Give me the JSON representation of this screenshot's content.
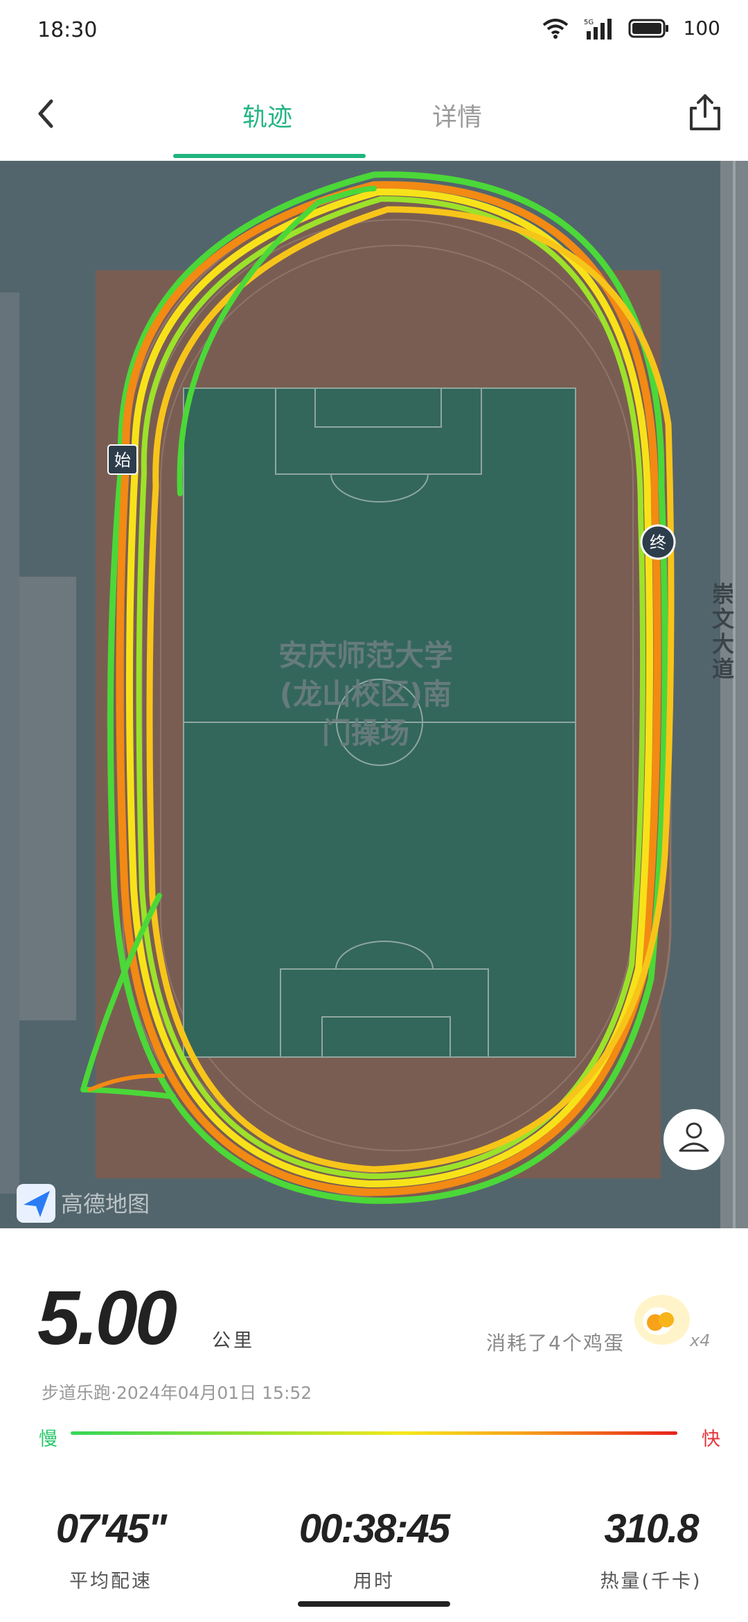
{
  "status_bar": {
    "time": "18:30",
    "battery": "100",
    "network": "5G"
  },
  "header": {
    "tabs": [
      {
        "label": "轨迹",
        "active": true
      },
      {
        "label": "详情",
        "active": false
      }
    ]
  },
  "map": {
    "venue_label_line1": "安庆师范大学",
    "venue_label_line2": "(龙山校区)南",
    "venue_label_line3": "门操场",
    "road_label": [
      "崇",
      "文",
      "大",
      "道"
    ],
    "start_marker": "始",
    "end_marker": "终",
    "provider": "高德地图"
  },
  "summary": {
    "distance": "5.00",
    "distance_unit": "公里",
    "eggs_text": "消耗了4个鸡蛋",
    "eggs_count": "x4",
    "subline": "步道乐跑·2024年04月01日 15:52",
    "speed_slow": "慢",
    "speed_fast": "快",
    "metrics": [
      {
        "value": "07'45\"",
        "label": "平均配速"
      },
      {
        "value": "00:38:45",
        "label": "用时"
      },
      {
        "value": "310.8",
        "label": "热量(千卡)"
      }
    ]
  }
}
